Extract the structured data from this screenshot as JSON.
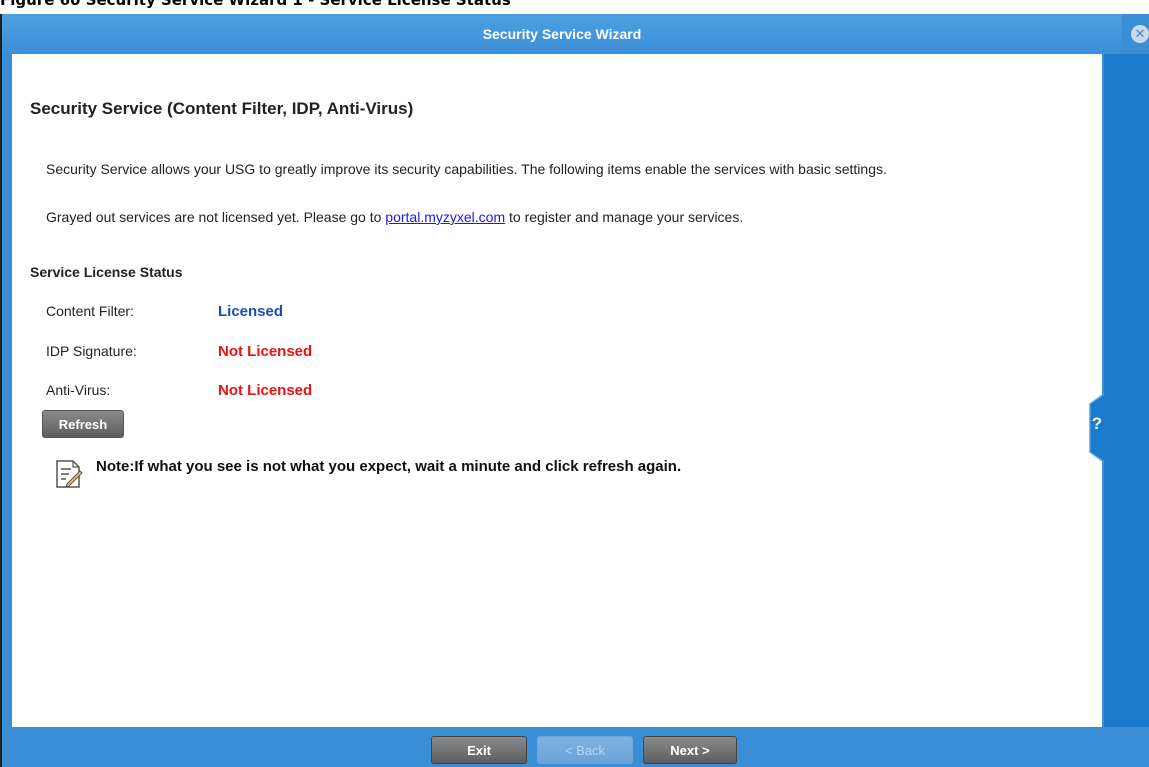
{
  "figure_caption": "Figure 60 Security Service Wizard 1 - Service License Status",
  "window": {
    "title": "Security Service Wizard",
    "close_icon": "close-circle-icon",
    "help_icon": "help-tab-icon",
    "help_glyph": "?"
  },
  "content": {
    "heading": "Security Service (Content Filter, IDP, Anti-Virus)",
    "intro": "Security Service allows your USG to greatly improve its security capabilities. The following items enable the services with basic settings.",
    "grayed_prefix": "Grayed out services are not licensed yet. Please go to ",
    "portal_link": "portal.myzyxel.com",
    "grayed_suffix": " to register and manage your services.",
    "status_heading": "Service License Status",
    "services": [
      {
        "label": "Content Filter:",
        "status": "Licensed",
        "color": "#1a4fb8"
      },
      {
        "label": "IDP Signature:",
        "status": "Not Licensed",
        "color": "#ee1111"
      },
      {
        "label": "Anti-Virus:",
        "status": "Not Licensed",
        "color": "#ee1111"
      }
    ],
    "refresh_label": "Refresh",
    "note_icon": "note-pencil-icon",
    "note": "Note:If what you see is not what you expect, wait a minute and click refresh again."
  },
  "footer": {
    "exit_label": "Exit",
    "back_label": "< Back",
    "back_enabled": false,
    "next_label": "Next >"
  },
  "colors": {
    "titlebar": "#3a8ed6",
    "side_rail": "#1a7bcc",
    "link": "#1a1aee"
  }
}
